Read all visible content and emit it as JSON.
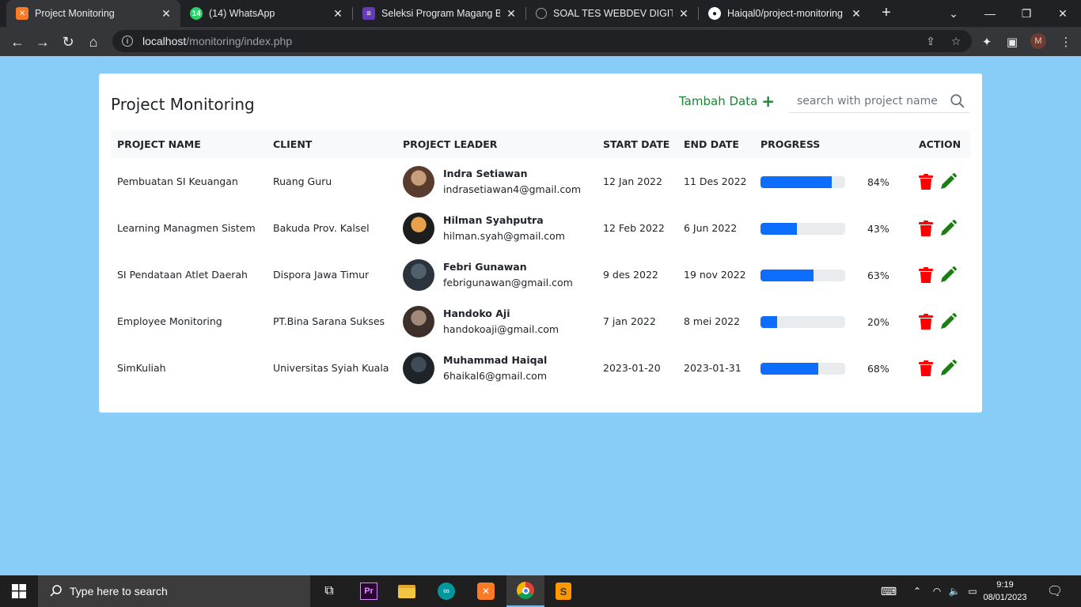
{
  "browser": {
    "tabs": [
      {
        "title": "Project Monitoring",
        "icon": "xampp-icon",
        "color": "#fb7a24",
        "active": true
      },
      {
        "title": "(14) WhatsApp",
        "icon": "whatsapp-icon",
        "color": "#25d366",
        "badge": "14"
      },
      {
        "title": "Seleksi Program Magang Ber",
        "icon": "forms-icon",
        "color": "#673ab7"
      },
      {
        "title": "SOAL TES WEBDEV DIGITALIZ",
        "icon": "globe-icon",
        "color": "#9aa0a6"
      },
      {
        "title": "Haiqal0/project-monitoring",
        "icon": "github-icon",
        "color": "#ffffff"
      }
    ],
    "url_host": "localhost",
    "url_path": "/monitoring/index.php",
    "profile_initial": "M"
  },
  "page": {
    "title": "Project Monitoring",
    "add_label": "Tambah Data",
    "search_placeholder": "search with project name",
    "columns": [
      "PROJECT NAME",
      "CLIENT",
      "PROJECT LEADER",
      "START DATE",
      "END DATE",
      "PROGRESS",
      "ACTION"
    ],
    "rows": [
      {
        "project": "Pembuatan SI Keuangan",
        "client": "Ruang Guru",
        "leader": "Indra Setiawan",
        "email": "indrasetiawan4@gmail.com",
        "start": "12 Jan 2022",
        "end": "11 Des 2022",
        "progress": 84,
        "progress_label": "84%"
      },
      {
        "project": "Learning Managmen Sistem",
        "client": "Bakuda Prov. Kalsel",
        "leader": "Hilman Syahputra",
        "email": "hilman.syah@gmail.com",
        "start": "12 Feb 2022",
        "end": "6 Jun 2022",
        "progress": 43,
        "progress_label": "43%"
      },
      {
        "project": "SI Pendataan Atlet Daerah",
        "client": "Dispora Jawa Timur",
        "leader": "Febri Gunawan",
        "email": "febrigunawan@gmail.com",
        "start": "9 des 2022",
        "end": "19 nov 2022",
        "progress": 63,
        "progress_label": "63%"
      },
      {
        "project": "Employee Monitoring",
        "client": "PT.Bina Sarana Sukses",
        "leader": "Handoko Aji",
        "email": "handokoaji@gmail.com",
        "start": "7 jan 2022",
        "end": "8 mei 2022",
        "progress": 20,
        "progress_label": "20%"
      },
      {
        "project": "SimKuliah",
        "client": "Universitas Syiah Kuala",
        "leader": "Muhammad Haiqal",
        "email": "6haikal6@gmail.com",
        "start": "2023-01-20",
        "end": "2023-01-31",
        "progress": 68,
        "progress_label": "68%"
      }
    ]
  },
  "taskbar": {
    "search_placeholder": "Type here to search",
    "time": "9:19",
    "date": "08/01/2023"
  },
  "colors": {
    "background": "#87cdf7",
    "accent_green": "#198734",
    "progress_blue": "#0d6efd",
    "delete_red": "#ff0000"
  }
}
